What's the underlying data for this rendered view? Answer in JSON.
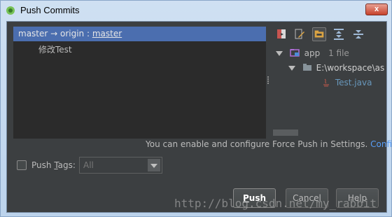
{
  "window": {
    "title": "Push Commits",
    "close_label": "x"
  },
  "commits": {
    "header_prefix": "master → origin : ",
    "header_branch": "master",
    "items": [
      "修改Test"
    ]
  },
  "tree": {
    "app_label": "app",
    "app_count": "1 file",
    "folder_label": "E:\\workspace\\as",
    "file_label": "Test.java"
  },
  "toolbar": {
    "icons": [
      "show-diff-icon",
      "edit-source-icon",
      "group-by-module-icon",
      "expand-all-icon",
      "collapse-all-icon"
    ]
  },
  "force_push": {
    "message": "You can enable and configure Force Push in Settings.",
    "link": "Configure"
  },
  "push_tags": {
    "label_pre": "Push ",
    "label_mnemonic": "T",
    "label_post": "ags:",
    "checked": false,
    "select_value": "All"
  },
  "buttons": {
    "push_pre": "",
    "push_mnemonic": "P",
    "push_post": "ush",
    "cancel": "Cancel",
    "help": "Help"
  },
  "watermark": "http://blog.csdn.net/my_rabbit",
  "colors": {
    "accent": "#4b6eaf",
    "link": "#589df6",
    "background": "#3c3f41"
  }
}
